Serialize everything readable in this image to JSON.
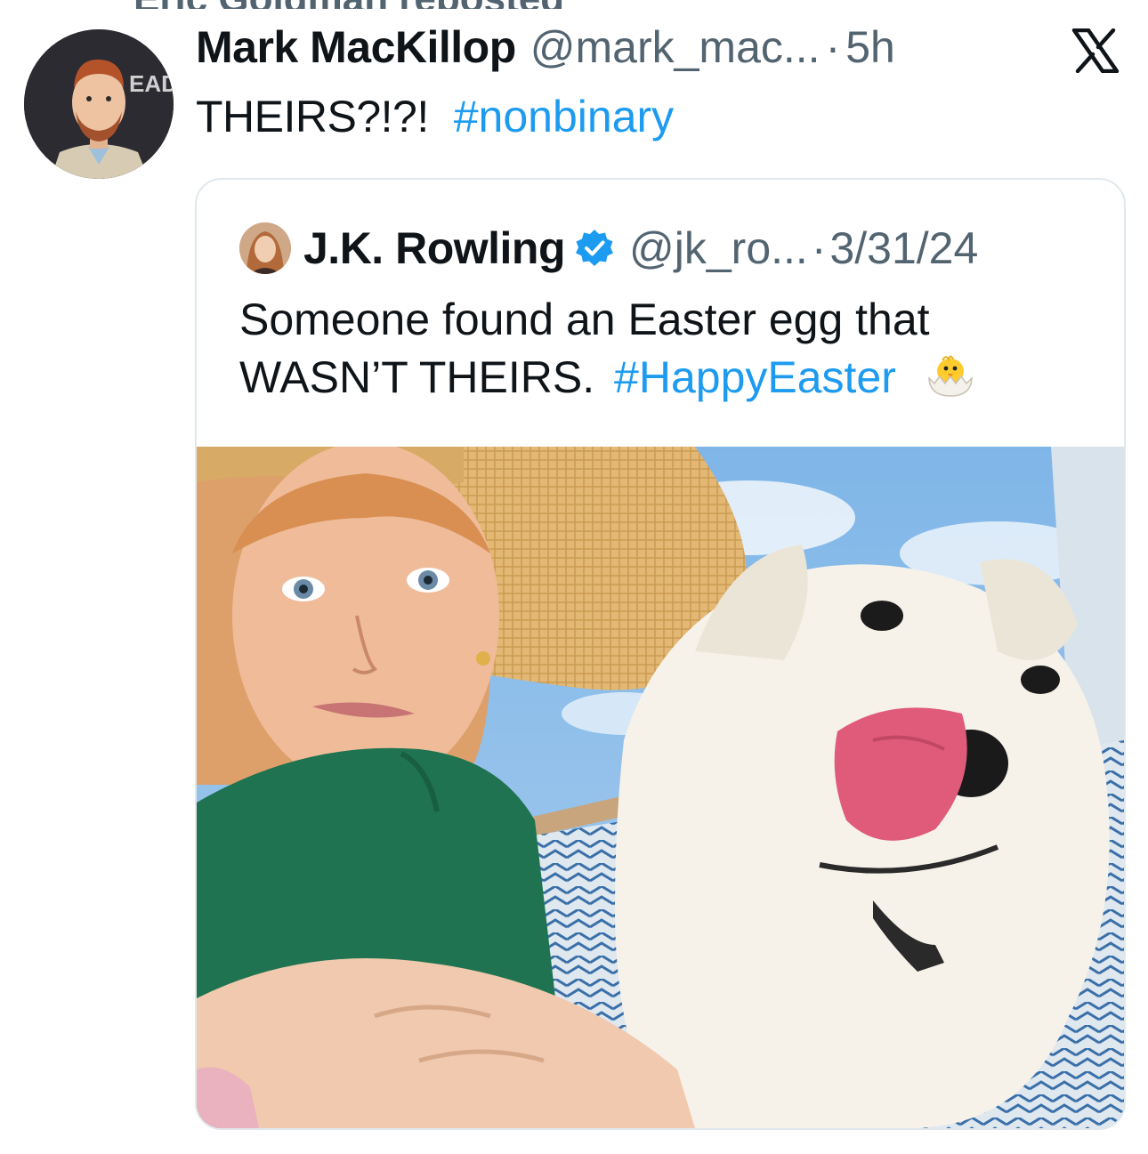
{
  "repost": {
    "label": "Eric Goldman reposted"
  },
  "author": {
    "name": "Mark MacKillop",
    "handle": "@mark_mac...",
    "separator": "·",
    "time": "5h",
    "avatar_text": "EAD"
  },
  "post": {
    "text": "THEIRS?!?!",
    "hashtag": "#nonbinary"
  },
  "brand": {
    "icon": "x-logo-icon"
  },
  "quote": {
    "name": "J.K. Rowling",
    "handle": "@jk_ro...",
    "separator": "·",
    "date": "3/31/24",
    "text": "Someone found an Easter egg that WASN’T THEIRS.",
    "hashtag": "#HappyEaster",
    "emoji": "hatching-chick-icon",
    "verified_icon": "verified-badge-icon",
    "photo_description": "selfie-with-dog-photo"
  },
  "colors": {
    "link": "#1d9bf0",
    "secondary_text": "#536471",
    "primary_text": "#0f1419",
    "card_border": "#e1e8ed"
  }
}
